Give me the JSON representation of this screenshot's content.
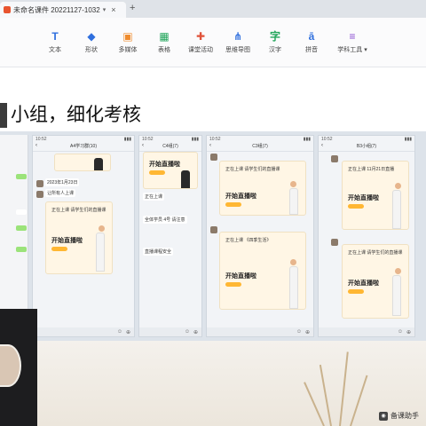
{
  "window": {
    "tab_title": "未命名课件 20221127-1032",
    "tab_close": "×",
    "tab_menu": "▾",
    "new_tab": "+"
  },
  "toolbar": {
    "items": [
      {
        "label": "文本",
        "icon": "T",
        "color": "#2f6fde"
      },
      {
        "label": "形状",
        "icon": "◆",
        "color": "#2f6fde"
      },
      {
        "label": "多媒体",
        "icon": "▣",
        "color": "#ef8b2c"
      },
      {
        "label": "表格",
        "icon": "▦",
        "color": "#22a55b"
      },
      {
        "label": "课堂活动",
        "icon": "✚",
        "color": "#e0523a"
      },
      {
        "label": "思维导图",
        "icon": "⋔",
        "color": "#2f6fde"
      },
      {
        "label": "汉字",
        "icon": "字",
        "color": "#22a55b"
      },
      {
        "label": "拼音",
        "icon": "ā",
        "color": "#2f6fde"
      },
      {
        "label": "学科工具 ▾",
        "icon": "≡",
        "color": "#8a4ccf"
      }
    ]
  },
  "slide": {
    "heading": "小组，细化考核"
  },
  "panels": [
    {
      "title": "A4学习群(10)",
      "live": "开始直播啦",
      "msgs": [
        "2023年1月23日",
        "让所有人上课",
        "正在上课 请学生们的直播课"
      ]
    },
    {
      "title": "C4组(7)",
      "live": "开始直播啦",
      "msgs": [
        "正在上课",
        "全体学员 4号 请注意",
        "直播课程安全"
      ]
    },
    {
      "title": "C3组(7)",
      "live": "开始直播啦",
      "msgs": [
        "正在上课 请学生们的直播课",
        "正在上课 《四季生活》"
      ]
    },
    {
      "title": "B3小组(7)",
      "live": "开始直播啦",
      "msgs": [
        "正在上课 11月21日直播",
        "正在上课 请学生们的直播课"
      ]
    }
  ],
  "watermark": {
    "text": "备课助手",
    "icon": "wechat-icon"
  }
}
